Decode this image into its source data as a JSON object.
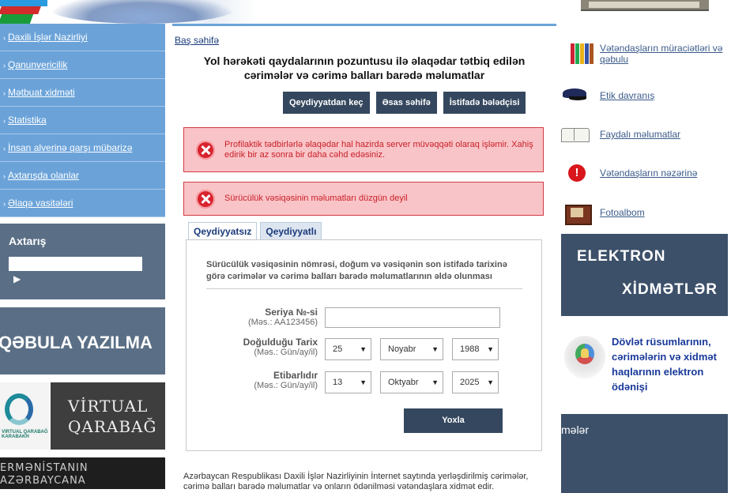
{
  "sidebar": {
    "items": [
      {
        "label": "Daxili İşlər Nazirliyi"
      },
      {
        "label": "Qanunvericilik"
      },
      {
        "label": "Mətbuat xidməti"
      },
      {
        "label": "Statistika"
      },
      {
        "label": "İnsan alverinə qarşı mübarizə"
      },
      {
        "label": "Axtarışda olanlar"
      },
      {
        "label": "Əlaqə vasitələri"
      }
    ],
    "search_title": "Axtarış",
    "search_button": "▶",
    "banner_qebula": "QƏBULA YAZILMA",
    "banner_virtual_line1": "VİRTUAL",
    "banner_virtual_line2": "QARABAĞ",
    "banner_virtual_logo": "VIRTUAL QARABAĞ KARABAKH",
    "banner_ermen_line1": "ERMƏNİSTANIN",
    "banner_ermen_line2": "AZƏRBAYCANA"
  },
  "main": {
    "breadcrumb": "Baş səhifə",
    "title": "Yol hərəkəti qaydalarının pozuntusu ilə əlaqədar tətbiq edilən cərimələr və cərimə balları barədə məlumatlar",
    "buttons": {
      "register": "Qeydiyyatdan keç",
      "home": "Əsas səhifə",
      "guide": "İstifadə bələdçisi"
    },
    "errors": {
      "server": "Profilaktik tədbirlərlə əlaqədar hal hazirda server müvəqqəti olaraq işləmir. Xahiş edirik bir az sonra bir daha cəhd edəsiniz.",
      "license": "Sürücülük vəsiqəsinin məlumatları düzgün deyil"
    },
    "tabs": {
      "unregistered": "Qeydiyyatsız",
      "registered": "Qeydiyyatlı"
    },
    "form": {
      "description": "Sürücülük vəsiqəsinin nömrəsi, doğum və vəsiqənin son istifadə tarixinə görə cərimələr və cərimə balları barədə məlumatlarının əldə olunması",
      "series_label": "Seriya №-si",
      "series_hint": "(Məs.: AA123456)",
      "series_value": "",
      "birth_label": "Doğulduğu Tarix",
      "birth_hint": "(Məs.: Gün/ay/il)",
      "birth_day": "25",
      "birth_month": "Noyabr",
      "birth_year": "1988",
      "valid_label": "Etibarlıdır",
      "valid_hint": "(Məs.: Gün/ay/il)",
      "valid_day": "13",
      "valid_month": "Oktyabr",
      "valid_year": "2025",
      "submit": "Yoxla"
    },
    "footer": "Azərbaycan Respublikası Daxili İşlər Nazirliyinin İnternet saytında yerləşdirilmiş cərimələr, cərimə balları barədə məlumatlar və onların ödənilməsi vətəndaşlara xidmət edir."
  },
  "right": {
    "links": [
      {
        "label": "Vətəndaşların müraciətləri və qəbulu",
        "icon": "books-icon"
      },
      {
        "label": "Etik davranış",
        "icon": "police-cap-icon"
      },
      {
        "label": "Faydalı məlumatlar",
        "icon": "open-book-icon"
      },
      {
        "label": "Vətəndaşların nəzərinə",
        "icon": "exclamation-icon"
      },
      {
        "label": "Fotoalbom",
        "icon": "photo-icon"
      }
    ],
    "elektron_line1": "ELEKTRON",
    "elektron_line2": "XİDMƏTLƏR",
    "dovlet_text": "Dövlət rüsumlarının, cərimələrin və xidmət haqlarının elektron ödənişi",
    "partial_text": "mələr"
  },
  "colors": {
    "nav_blue": "#6ba3d9",
    "dark_slate": "#34475e",
    "error_bg": "#f9c4c7",
    "error_red": "#c8202a",
    "link_blue": "#3b5b8a"
  }
}
